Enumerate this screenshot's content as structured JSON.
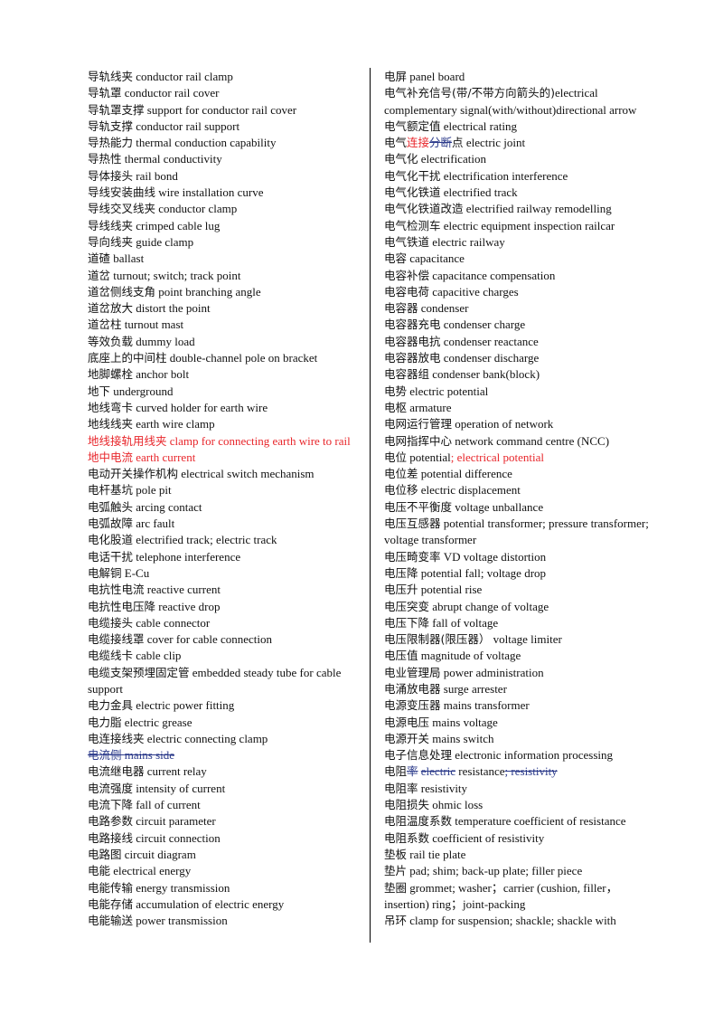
{
  "document": {
    "left_column": [
      {
        "zh": "导轨线夹",
        "en": "conductor rail clamp"
      },
      {
        "zh": "导轨罩",
        "en": "conductor rail cover"
      },
      {
        "zh": "导轨罩支撑",
        "en": "support for conductor rail cover"
      },
      {
        "zh": "导轨支撑",
        "en": "conductor rail support"
      },
      {
        "zh": "导热能力",
        "en": "thermal conduction capability"
      },
      {
        "zh": "导热性",
        "en": "thermal conductivity"
      },
      {
        "zh": "导体接头",
        "en": "rail bond"
      },
      {
        "zh": "导线安装曲线",
        "en": "wire installation curve"
      },
      {
        "zh": "导线交叉线夹",
        "en": "conductor clamp"
      },
      {
        "zh": "导线线夹",
        "en": "crimped cable lug"
      },
      {
        "zh": "导向线夹",
        "en": "guide clamp"
      },
      {
        "zh": "道碴",
        "en": "ballast"
      },
      {
        "zh": "道岔",
        "en": "turnout; switch; track point"
      },
      {
        "zh": "道岔侧线支角",
        "en": "point branching angle"
      },
      {
        "zh": "道岔放大",
        "en": "distort the point"
      },
      {
        "zh": "道岔柱",
        "en": "turnout mast"
      },
      {
        "zh": "等效负载",
        "en": "dummy load"
      },
      {
        "zh": "底座上的中间柱",
        "en": "double-channel pole on bracket"
      },
      {
        "zh": "地脚螺栓",
        "en": "anchor bolt"
      },
      {
        "zh": "地下",
        "en": "underground"
      },
      {
        "zh": "地线弯卡",
        "en": "curved holder for earth wire"
      },
      {
        "zh": "地线线夹",
        "en": "earth wire clamp"
      },
      {
        "zh": "地线接轨用线夹",
        "en": "clamp for connecting earth wire to rail",
        "style": "red"
      },
      {
        "zh": "地中电流",
        "en": "earth current",
        "style": "red"
      },
      {
        "zh": "电动开关操作机构",
        "en": "electrical switch mechanism"
      },
      {
        "zh": "电杆基坑",
        "en": "pole pit"
      },
      {
        "zh": "电弧触头",
        "en": "arcing contact"
      },
      {
        "zh": "电弧故障",
        "en": "arc fault"
      },
      {
        "zh": "电化股道",
        "en": "electrified track; electric track"
      },
      {
        "zh": "电话干扰",
        "en": "telephone interference"
      },
      {
        "zh": "电解铜",
        "en": "E-Cu"
      },
      {
        "zh": "电抗性电流",
        "en": "reactive current"
      },
      {
        "zh": "电抗性电压降",
        "en": "reactive drop"
      },
      {
        "zh": "电缆接头",
        "en": "cable connector"
      },
      {
        "zh": "电缆接线罩",
        "en": "cover for cable connection"
      },
      {
        "zh": "电缆线卡",
        "en": "cable clip"
      },
      {
        "zh": "电缆支架预埋固定管",
        "en": "embedded steady tube for cable support"
      },
      {
        "zh": "电力金具",
        "en": "electric power fitting"
      },
      {
        "zh": "电力脂",
        "en": "electric grease"
      },
      {
        "zh": "电连接线夹",
        "en": "electric connecting clamp"
      },
      {
        "zh": "电流侧",
        "en": "mains side",
        "style": "struck"
      },
      {
        "zh": "电流继电器",
        "en": "current relay"
      },
      {
        "zh": "电流强度",
        "en": "intensity of current"
      },
      {
        "zh": "电流下降",
        "en": "fall of current"
      },
      {
        "zh": "电路参数",
        "en": "circuit parameter"
      },
      {
        "zh": "电路接线",
        "en": "circuit connection"
      },
      {
        "zh": "电路图",
        "en": "circuit diagram"
      },
      {
        "zh": "电能",
        "en": "electrical energy"
      },
      {
        "zh": "电能传输",
        "en": "energy transmission"
      },
      {
        "zh": "电能存储",
        "en": "accumulation of electric energy"
      },
      {
        "zh": "电能输送",
        "en": "power transmission"
      }
    ],
    "right_column": [
      {
        "zh": "电屏",
        "en": "panel board"
      },
      {
        "zh": "电气补充信号(带/不带方向箭头的)",
        "en": "electrical complementary signal(with/without)directional arrow",
        "nospace": true
      },
      {
        "zh": "电气额定值",
        "en": "electrical rating"
      },
      {
        "segments": [
          {
            "text": "电气",
            "style": "zh"
          },
          {
            "text": "连接",
            "style": "zh red"
          },
          {
            "text": "分断",
            "style": "zh struck"
          },
          {
            "text": "点",
            "style": "zh"
          },
          {
            "text": " electric joint",
            "style": ""
          }
        ]
      },
      {
        "zh": "电气化",
        "en": "electrification"
      },
      {
        "zh": "电气化干扰",
        "en": "electrification interference"
      },
      {
        "zh": "电气化铁道",
        "en": "electrified track"
      },
      {
        "zh": "电气化铁道改造",
        "en": "electrified railway remodelling"
      },
      {
        "zh": "电气检测车",
        "en": "electric equipment inspection railcar"
      },
      {
        "zh": "电气铁道",
        "en": "electric railway"
      },
      {
        "zh": "电容",
        "en": "capacitance"
      },
      {
        "zh": "电容补偿",
        "en": "capacitance compensation"
      },
      {
        "zh": "电容电荷",
        "en": "capacitive charges"
      },
      {
        "zh": "电容器",
        "en": "condenser"
      },
      {
        "zh": "电容器充电",
        "en": "condenser charge"
      },
      {
        "zh": "电容器电抗",
        "en": "condenser reactance"
      },
      {
        "zh": "电容器放电",
        "en": "condenser discharge"
      },
      {
        "zh": "电容器组",
        "en": "condenser bank(block)"
      },
      {
        "zh": "电势",
        "en": "electric potential"
      },
      {
        "zh": "电枢",
        "en": "armature"
      },
      {
        "zh": "电网运行管理",
        "en": "operation of network"
      },
      {
        "zh": "电网指挥中心",
        "en": "network command centre (NCC)"
      },
      {
        "segments": [
          {
            "text": "电位",
            "style": "zh"
          },
          {
            "text": " potential",
            "style": ""
          },
          {
            "text": "; electrical potential",
            "style": "red"
          }
        ]
      },
      {
        "zh": "电位差",
        "en": "potential difference"
      },
      {
        "zh": "电位移",
        "en": "electric displacement"
      },
      {
        "zh": "电压不平衡度",
        "en": "voltage unballance"
      },
      {
        "zh": "电压互感器",
        "en": "potential transformer; pressure transformer; voltage transformer"
      },
      {
        "zh": "电压畸变率",
        "en": "VD voltage distortion"
      },
      {
        "zh": "电压降",
        "en": "potential fall; voltage drop"
      },
      {
        "zh": "电压升",
        "en": "potential rise"
      },
      {
        "zh": "电压突变",
        "en": "abrupt change of voltage"
      },
      {
        "zh": "电压下降",
        "en": "fall of voltage"
      },
      {
        "zh": "电压限制器(限压器）",
        "en": "voltage limiter"
      },
      {
        "zh": "电压值",
        "en": "magnitude of voltage"
      },
      {
        "zh": "电业管理局",
        "en": "power administration"
      },
      {
        "zh": "电涌放电器",
        "en": "surge arrester"
      },
      {
        "zh": "电源变压器",
        "en": "mains transformer"
      },
      {
        "zh": "电源电压",
        "en": "mains voltage"
      },
      {
        "zh": "电源开关",
        "en": "mains switch"
      },
      {
        "zh": "电子信息处理",
        "en": "electronic information processing"
      },
      {
        "segments": [
          {
            "text": "电阻",
            "style": "zh"
          },
          {
            "text": "率",
            "style": "zh struck"
          },
          {
            "text": " ",
            "style": ""
          },
          {
            "text": "electric",
            "style": "struck"
          },
          {
            "text": " resistance",
            "style": ""
          },
          {
            "text": "; resistivity",
            "style": "struck"
          }
        ]
      },
      {
        "zh": "电阻率",
        "en": "resistivity"
      },
      {
        "zh": "电阻损失",
        "en": "ohmic loss"
      },
      {
        "zh": "电阻温度系数",
        "en": "temperature coefficient of resistance"
      },
      {
        "zh": "电阻系数",
        "en": "coefficient of resistivity"
      },
      {
        "zh": "垫板",
        "en": "rail tie plate"
      },
      {
        "zh": "垫片",
        "en": " pad; shim; back-up plate; filler piece"
      },
      {
        "zh": "垫圈",
        "en": "grommet; washer；carrier (cushion, filler，insertion) ring；joint-packing"
      },
      {
        "zh": "吊环",
        "en": "clamp for suspension; shackle; shackle with"
      }
    ]
  }
}
